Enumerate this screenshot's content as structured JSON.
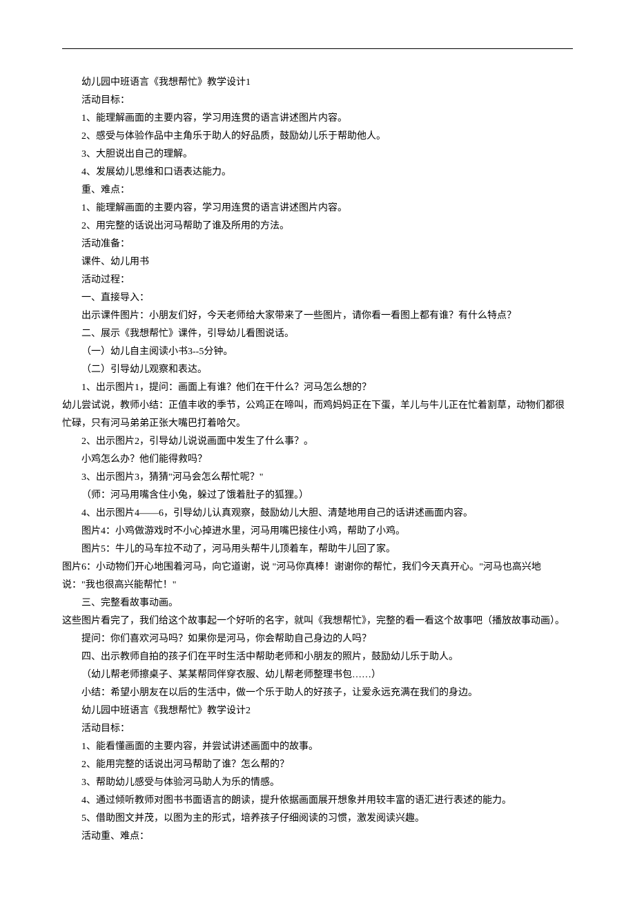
{
  "lines": [
    "幼儿园中班语言《我想帮忙》教学设计1",
    "活动目标：",
    "1、能理解画面的主要内容，学习用连贯的语言讲述图片内容。",
    "2、感受与体验作品中主角乐于助人的好品质，鼓励幼儿乐于帮助他人。",
    "3、大胆说出自己的理解。",
    "4、发展幼儿思维和口语表达能力。",
    "重、难点：",
    "1、能理解画面的主要内容，学习用连贯的语言讲述图片内容。",
    "2、用完整的话说出河马帮助了谁及所用的方法。",
    "活动准备：",
    "课件、幼儿用书",
    "活动过程：",
    "一、直接导入：",
    "出示课件图片：小朋友们好，今天老师给大家带来了一些图片，请你看一看图上都有谁？有什么特点？",
    "二、展示《我想帮忙》课件，引导幼儿看图说话。",
    "（一）幼儿自主阅读小书3--5分钟。",
    "（二）引导幼儿观察和表达。",
    "1、出示图片1，提问：画面上有谁？他们在干什么？河马怎么想的？",
    "幼儿尝试说，教师小结：正值丰收的季节，公鸡正在啼叫，而鸡妈妈正在下蛋，羊儿与牛儿正在忙着割草，动物们都很忙碌，只有河马弟弟正张大嘴巴打着哈欠。",
    "2、出示图片2，引导幼儿说说画面中发生了什么事？。",
    "小鸡怎么办？他们能得救吗？",
    "3、出示图片3，猜猜\"河马会怎么帮忙呢？\"",
    "（师：河马用嘴含住小兔，躲过了饿着肚子的狐狸。）",
    "4、出示图片4——6，引导幼儿认真观察，鼓励幼儿大胆、清楚地用自己的话讲述画面内容。",
    "图片4：小鸡做游戏时不小心掉进水里，河马用嘴巴接住小鸡，帮助了小鸡。",
    "图片5：牛儿的马车拉不动了，河马用头帮牛儿顶着车，帮助牛儿回了家。",
    "图片6：小动物们开心地围着河马，向它道谢，说 \"河马你真棒！谢谢你的帮忙，我们今天真开心。\"河马也高兴地说：\"我也很高兴能帮忙！\"",
    "三、完整看故事动画。",
    "这些图片看完了，我们给这个故事起一个好听的名字，就叫《我想帮忙》，完整的看一看这个故事吧（播放故事动画）。",
    "提问：你们喜欢河马吗？如果你是河马，你会帮助自己身边的人吗？",
    "四、出示教师自拍的孩子们在平时生活中帮助老师和小朋友的照片，鼓励幼儿乐于助人。",
    "（幼儿帮老师擦桌子、某某帮同伴穿衣服、幼儿帮老师整理书包……）",
    "小结：希望小朋友在以后的生活中，做一个乐于助人的好孩子，让爱永远充满在我们的身边。",
    "幼儿园中班语言《我想帮忙》教学设计2",
    "活动目标：",
    "1、能看懂画面的主要内容，并尝试讲述画面中的故事。",
    "2、能用完整的话说出河马帮助了谁？怎么帮的？",
    "3、帮助幼儿感受与体验河马助人为乐的情感。",
    "4、通过倾听教师对图书书面语言的朗读，提升依据画面展开想象并用较丰富的语汇进行表述的能力。",
    "5、借助图文并茂，以图为主的形式，培养孩子仔细阅读的习惯，激发阅读兴趣。",
    "活动重、难点："
  ],
  "noIndentLines": [
    18,
    26,
    28
  ]
}
